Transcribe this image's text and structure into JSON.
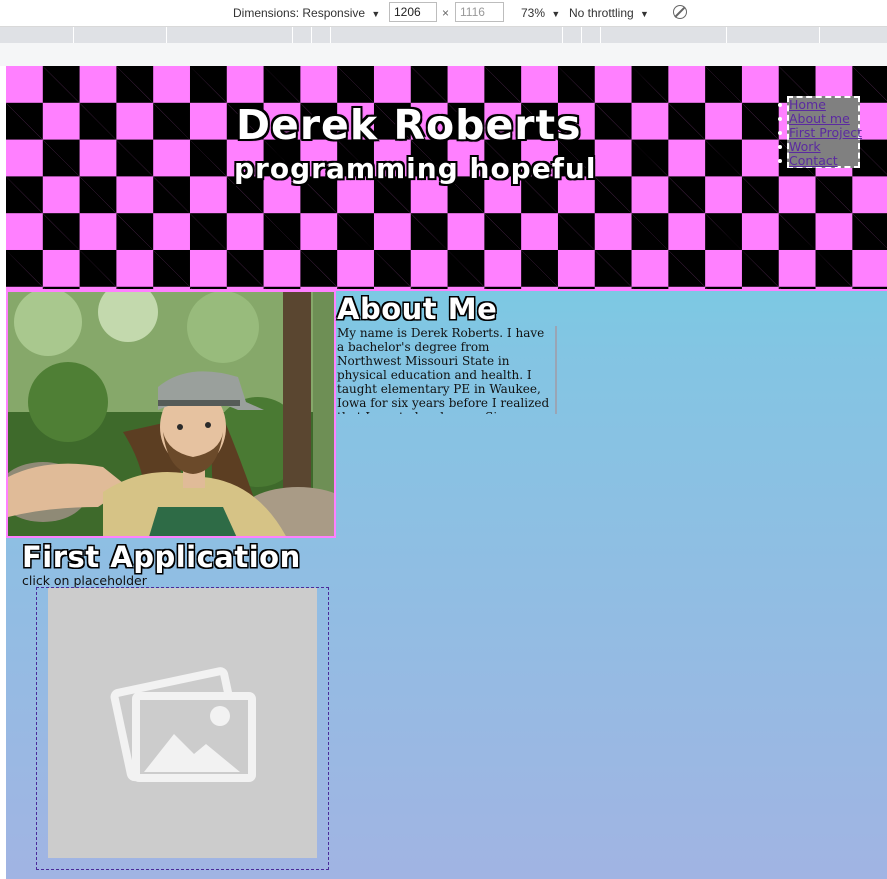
{
  "devtools": {
    "dimensions_label": "Dimensions: Responsive",
    "width_value": "1206",
    "times": "×",
    "height_placeholder": "1116",
    "zoom": "73%",
    "throttling": "No throttling",
    "caret": "▼"
  },
  "site": {
    "title": "Derek Roberts",
    "subtitle": "programming hopeful",
    "nav": [
      "Home",
      "About me",
      "First Project",
      "Work",
      "Contact"
    ],
    "about_heading": "About Me",
    "about_text": "My name is Derek Roberts. I have a bachelor's degree from Northwest Missouri State in physical education and health. I taught elementary PE in Waukee, Iowa for six years before I realized that I wanted a change. Since then, I have tried out a fair",
    "app_heading": "First Application",
    "app_caption": "click on placeholder"
  },
  "colors": {
    "checker_pink": "#ff80ff",
    "checker_black": "#000000",
    "gradient_top": "#62d6e4",
    "gradient_bottom": "#a1b4e3",
    "nav_bg": "#808080",
    "link": "#5b2aa0"
  },
  "icons": {
    "no_throttle": "no-throttle-icon",
    "image_placeholder": "image-placeholder-icon"
  }
}
